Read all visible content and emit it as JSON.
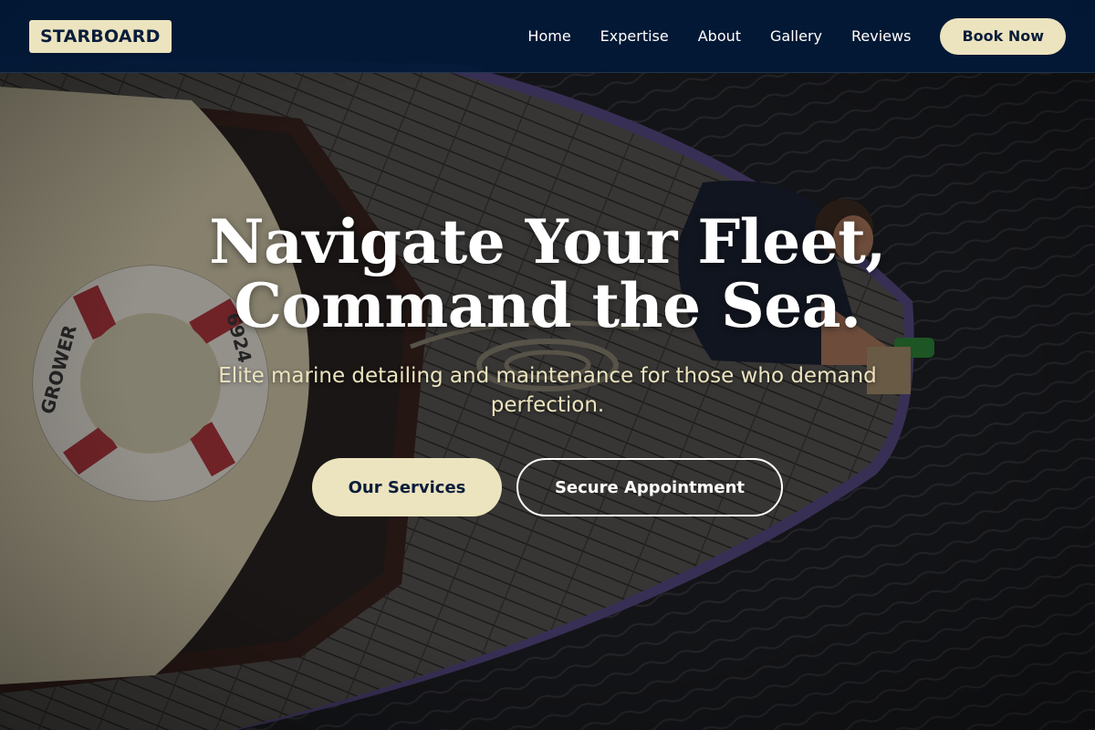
{
  "brand": {
    "logo_text": "STARBOARD"
  },
  "nav": {
    "items": [
      {
        "label": "Home"
      },
      {
        "label": "Expertise"
      },
      {
        "label": "About"
      },
      {
        "label": "Gallery"
      },
      {
        "label": "Reviews"
      }
    ],
    "cta_label": "Book Now"
  },
  "hero": {
    "headline_line1": "Navigate Your Fleet,",
    "headline_line2": "Command the Sea.",
    "subtitle": "Elite marine detailing and maintenance for those who demand perfection.",
    "primary_button": "Our Services",
    "secondary_button": "Secure Appointment",
    "life_ring_text": "GROWER 6924"
  },
  "colors": {
    "header_bg": "#021937",
    "accent_cream": "#ece4bf",
    "navy_text": "#0a1d3b",
    "water": "#1a1b20",
    "deck_wood": "#4a4845"
  },
  "icons": {
    "background_image": "boat-deck-aerial-photo"
  }
}
